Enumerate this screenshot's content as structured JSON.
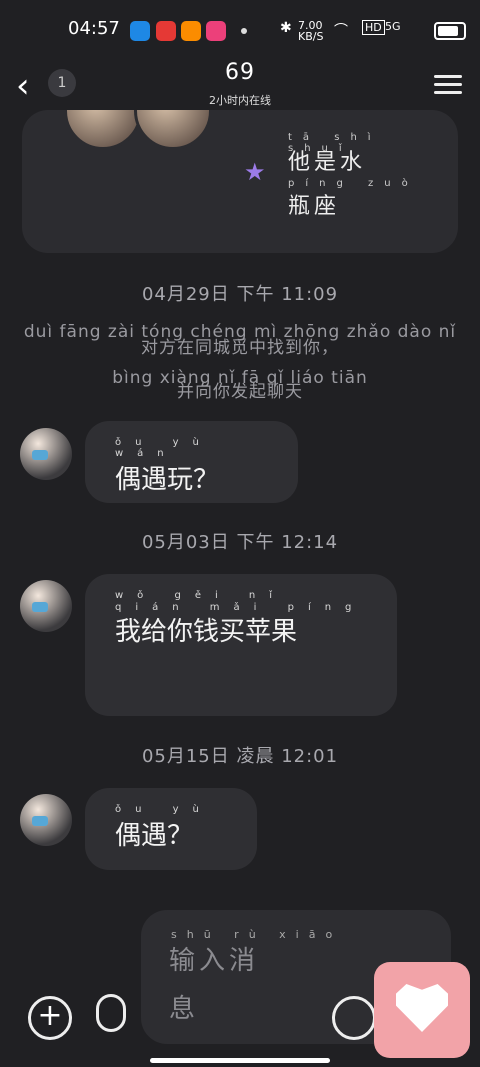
{
  "status_bar": {
    "time": "04:57",
    "network_speed": "7.00",
    "network_unit": "KB/S",
    "hd": "HD",
    "signal": "5G"
  },
  "header": {
    "back_count": "1",
    "title": "69",
    "subtitle": "2小时内在线"
  },
  "profile_card": {
    "sign_line1": "他是水",
    "sign_line2": "瓶座",
    "pinyin1": "tā shì shuǐ",
    "pinyin2": "píng zuò"
  },
  "timeline": [
    {
      "label": "04月29日 下午 11:09"
    },
    {
      "label": "05月03日 下午 12:14"
    },
    {
      "label": "05月15日 凌晨 12:01"
    }
  ],
  "notice": {
    "line1": "对方在同城觅中找到你，",
    "line2": "并向你发起聊天",
    "pinyin1": "duì fāng zài tóng chéng mì zhōng zhǎo dào nǐ",
    "pinyin2": "bìng xiàng nǐ fā qǐ liáo tiān"
  },
  "messages": [
    {
      "text": "偶遇玩？",
      "pinyin": "ǒu yù wán"
    },
    {
      "text": "我给你钱买苹果",
      "pinyin": "wǒ gěi nǐ qián mǎi píng"
    },
    {
      "text": "偶遇？",
      "pinyin": "ǒu yù"
    }
  ],
  "composer": {
    "placeholder_line1": "输入消",
    "placeholder_line2": "息",
    "pinyin": "shū rù xiāo"
  }
}
